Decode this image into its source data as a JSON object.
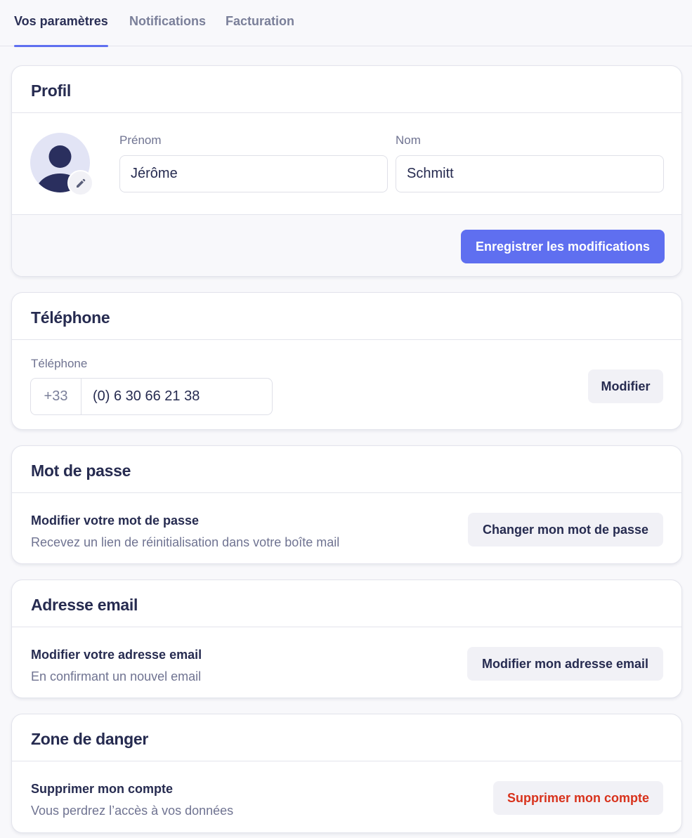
{
  "tabs": [
    {
      "label": "Vos paramètres",
      "active": true
    },
    {
      "label": "Notifications",
      "active": false
    },
    {
      "label": "Facturation",
      "active": false
    }
  ],
  "profile": {
    "title": "Profil",
    "first_name_label": "Prénom",
    "first_name_value": "Jérôme",
    "last_name_label": "Nom",
    "last_name_value": "Schmitt",
    "save_label": "Enregistrer les modifications"
  },
  "phone": {
    "title": "Téléphone",
    "field_label": "Téléphone",
    "country_code": "+33",
    "number": "(0) 6 30 66 21 38",
    "edit_label": "Modifier"
  },
  "password": {
    "title": "Mot de passe",
    "row_title": "Modifier votre mot de passe",
    "row_desc": "Recevez un lien de réinitialisation dans votre boîte mail",
    "button_label": "Changer mon mot de passe"
  },
  "email": {
    "title": "Adresse email",
    "row_title": "Modifier votre adresse email",
    "row_desc": "En confirmant un nouvel email",
    "button_label": "Modifier mon adresse email"
  },
  "danger": {
    "title": "Zone de danger",
    "row_title": "Supprimer mon compte",
    "row_desc": "Vous perdrez l’accès à vos données",
    "button_label": "Supprimer mon compte"
  },
  "colors": {
    "accent": "#5f6ff0",
    "danger": "#d8321c",
    "text": "#262b50",
    "muted": "#6f7391"
  },
  "icons": {
    "avatar": "user-avatar-icon",
    "edit": "pencil-icon"
  }
}
